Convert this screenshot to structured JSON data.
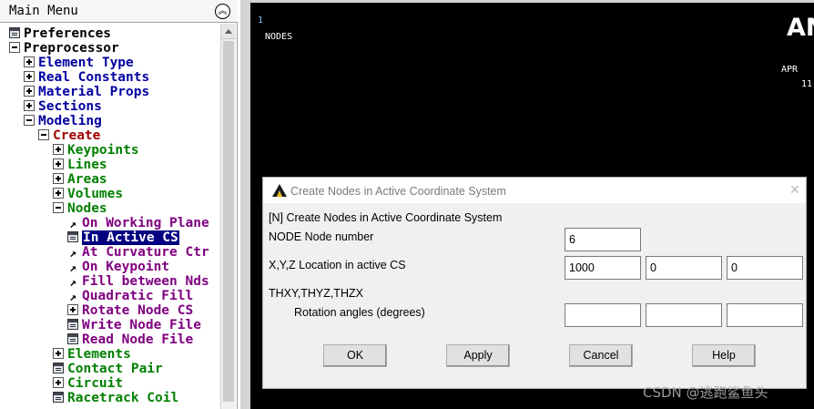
{
  "menu": {
    "title": "Main Menu",
    "items": [
      {
        "label": "Preferences",
        "icon": "dialog-icon",
        "color": "#000000"
      },
      {
        "label": "Preprocessor",
        "icon": "minus-icon",
        "color": "#000000"
      },
      {
        "label": "Element Type",
        "icon": "plus-icon",
        "color": "#0000a0"
      },
      {
        "label": "Real Constants",
        "icon": "plus-icon",
        "color": "#0000a0"
      },
      {
        "label": "Material Props",
        "icon": "plus-icon",
        "color": "#0000a0"
      },
      {
        "label": "Sections",
        "icon": "plus-icon",
        "color": "#0000a0"
      },
      {
        "label": "Modeling",
        "icon": "minus-icon",
        "color": "#0000a0"
      },
      {
        "label": "Create",
        "icon": "minus-icon",
        "color": "#a00000"
      },
      {
        "label": "Keypoints",
        "icon": "plus-icon",
        "color": "#008000"
      },
      {
        "label": "Lines",
        "icon": "plus-icon",
        "color": "#008000"
      },
      {
        "label": "Areas",
        "icon": "plus-icon",
        "color": "#008000"
      },
      {
        "label": "Volumes",
        "icon": "plus-icon",
        "color": "#008000"
      },
      {
        "label": "Nodes",
        "icon": "minus-icon",
        "color": "#008000"
      },
      {
        "label": "On Working Plane",
        "icon": "arrow-pick-icon",
        "color": "#800080"
      },
      {
        "label": "In Active CS",
        "icon": "dialog-icon",
        "color": "#800080",
        "selected": true
      },
      {
        "label": "At Curvature Ctr",
        "icon": "arrow-pick-icon",
        "color": "#800080"
      },
      {
        "label": "On Keypoint",
        "icon": "arrow-pick-icon",
        "color": "#800080"
      },
      {
        "label": "Fill between Nds",
        "icon": "arrow-pick-icon",
        "color": "#800080"
      },
      {
        "label": "Quadratic Fill",
        "icon": "arrow-pick-icon",
        "color": "#800080"
      },
      {
        "label": "Rotate Node CS",
        "icon": "plus-icon",
        "color": "#800080"
      },
      {
        "label": "Write Node File",
        "icon": "dialog-icon",
        "color": "#800080"
      },
      {
        "label": "Read Node File",
        "icon": "dialog-icon",
        "color": "#800080"
      },
      {
        "label": "Elements",
        "icon": "plus-icon",
        "color": "#008000"
      },
      {
        "label": "Contact Pair",
        "icon": "dialog-icon",
        "color": "#008000"
      },
      {
        "label": "Circuit",
        "icon": "plus-icon",
        "color": "#008000"
      },
      {
        "label": "Racetrack Coil",
        "icon": "dialog-icon",
        "color": "#008000"
      }
    ]
  },
  "graphics": {
    "window_number": "1",
    "label": "NODES",
    "logo": "AN",
    "date": "APR",
    "time": "11"
  },
  "dialog": {
    "title": "Create Nodes in Active Coordinate System",
    "close_symbol": "✕",
    "command": "[N]  Create Nodes in Active Coordinate System",
    "node_label": "NODE   Node number",
    "node_value": "6",
    "xyz_label": "X,Y,Z  Location in active CS",
    "x_value": "1000",
    "y_value": "0",
    "z_value": "0",
    "theta_label": "THXY,THYZ,THZX",
    "rotation_label": "Rotation angles (degrees)",
    "thxy_value": "",
    "thyz_value": "",
    "thzx_value": "",
    "buttons": {
      "ok": "OK",
      "apply": "Apply",
      "cancel": "Cancel",
      "help": "Help"
    }
  },
  "watermark": "CSDN @逃跑鲨鱼头"
}
